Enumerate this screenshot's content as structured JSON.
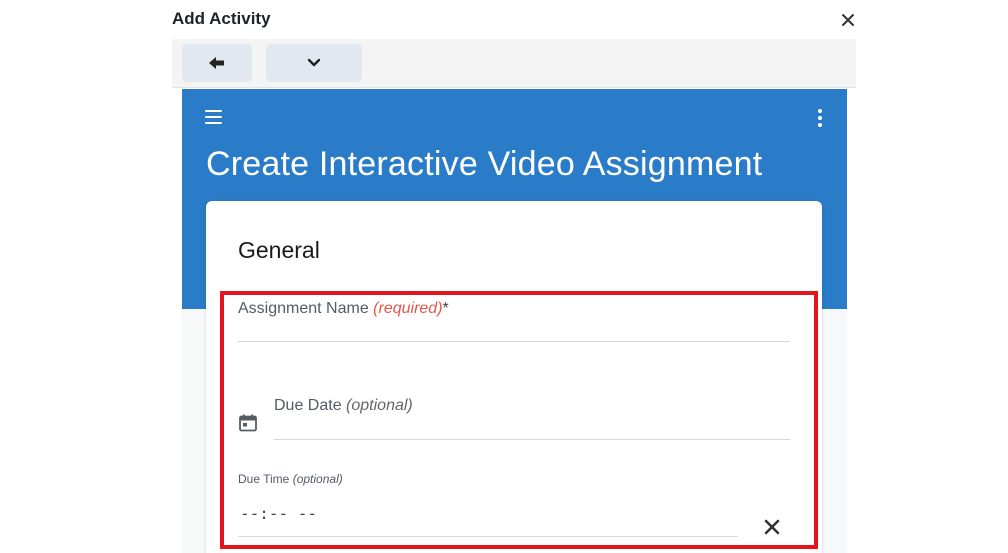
{
  "dialog": {
    "title": "Add Activity",
    "close_icon": "close-icon"
  },
  "toolbar": {
    "back_icon": "back-arrow-icon",
    "more_icon": "chevron-down-icon"
  },
  "app": {
    "title": "Create Interactive Video Assignment",
    "header_color": "#2a7bc8",
    "menu_icon": "hamburger-menu-icon",
    "kebab_icon": "more-vertical-icon"
  },
  "form": {
    "section_title": "General",
    "assignment_name": {
      "label": "Assignment Name",
      "required_hint": "(required)",
      "asterisk": "*",
      "value": ""
    },
    "due_date": {
      "label": "Due Date",
      "optional_hint": "(optional)",
      "icon": "calendar-icon",
      "value": ""
    },
    "due_time": {
      "label": "Due Time",
      "optional_hint": "(optional)",
      "value": "--:-- --",
      "clear_icon": "clear-icon"
    }
  },
  "highlight_color": "#e3141b"
}
